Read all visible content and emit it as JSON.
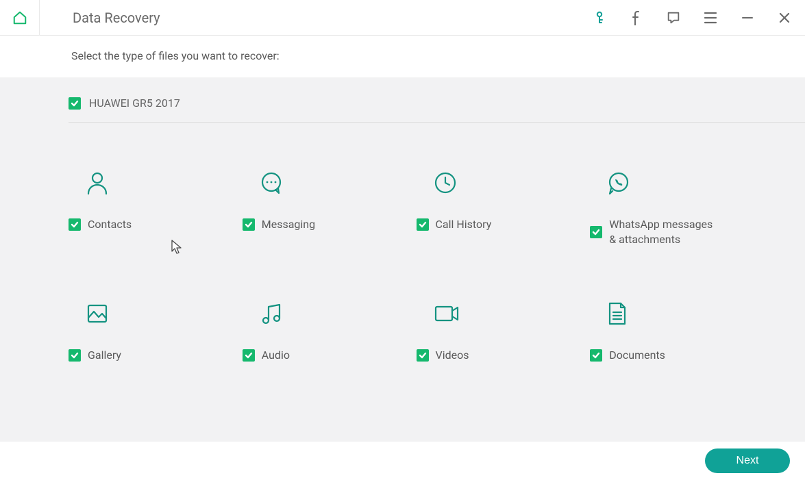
{
  "header": {
    "title": "Data Recovery"
  },
  "sub": {
    "instruction": "Select the type of files you want to recover:"
  },
  "device": {
    "name": "HUAWEI GR5 2017",
    "checked": true
  },
  "tiles": [
    {
      "id": "contacts",
      "label": "Contacts",
      "icon": "person",
      "checked": true
    },
    {
      "id": "messaging",
      "label": "Messaging",
      "icon": "chat",
      "checked": true
    },
    {
      "id": "calls",
      "label": "Call History",
      "icon": "clock",
      "checked": true
    },
    {
      "id": "whatsapp",
      "label": "WhatsApp messages & attachments",
      "icon": "whatsapp",
      "checked": true
    },
    {
      "id": "gallery",
      "label": "Gallery",
      "icon": "image",
      "checked": true
    },
    {
      "id": "audio",
      "label": "Audio",
      "icon": "music",
      "checked": true
    },
    {
      "id": "videos",
      "label": "Videos",
      "icon": "video",
      "checked": true
    },
    {
      "id": "documents",
      "label": "Documents",
      "icon": "doc",
      "checked": true
    }
  ],
  "footer": {
    "next": "Next"
  },
  "colors": {
    "accent_green": "#15b86d",
    "icon_teal": "#149381",
    "button_teal": "#10a297"
  }
}
